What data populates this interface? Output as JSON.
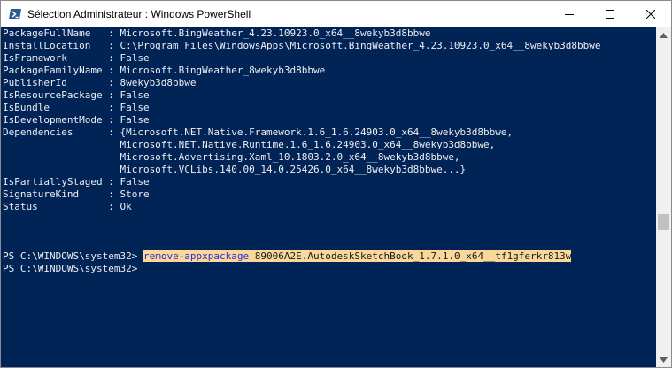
{
  "window": {
    "title": "Sélection Administrateur : Windows PowerShell",
    "icons": {
      "app": "powershell-icon",
      "minimize": "minimize-icon",
      "maximize": "maximize-icon",
      "close": "close-icon"
    }
  },
  "console": {
    "lines": [
      "PackageFullName   : Microsoft.BingWeather_4.23.10923.0_x64__8wekyb3d8bbwe",
      "InstallLocation   : C:\\Program Files\\WindowsApps\\Microsoft.BingWeather_4.23.10923.0_x64__8wekyb3d8bbwe",
      "IsFramework       : False",
      "PackageFamilyName : Microsoft.BingWeather_8wekyb3d8bbwe",
      "PublisherId       : 8wekyb3d8bbwe",
      "IsResourcePackage : False",
      "IsBundle          : False",
      "IsDevelopmentMode : False",
      "Dependencies      : {Microsoft.NET.Native.Framework.1.6_1.6.24903.0_x64__8wekyb3d8bbwe,",
      "                    Microsoft.NET.Native.Runtime.1.6_1.6.24903.0_x64__8wekyb3d8bbwe,",
      "                    Microsoft.Advertising.Xaml_10.1803.2.0_x64__8wekyb3d8bbwe,",
      "                    Microsoft.VCLibs.140.00_14.0.25426.0_x64__8wekyb3d8bbwe...}",
      "IsPartiallyStaged : False",
      "SignatureKind     : Store",
      "Status            : Ok"
    ],
    "prompt": "PS C:\\WINDOWS\\system32> ",
    "command_verb": "remove-appxpackage",
    "command_arg": " 89006A2E.AutodeskSketchBook_1.7.1.0_x64__tf1gferkr813w",
    "final_prompt": "PS C:\\WINDOWS\\system32>"
  },
  "colors": {
    "console_bg": "#012456",
    "console_fg": "#eeedf0",
    "selection_bg": "#f9d89a",
    "cmdlet_fg": "#2d2dd6"
  }
}
